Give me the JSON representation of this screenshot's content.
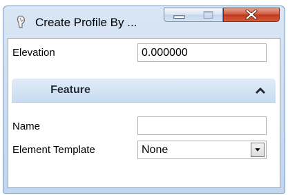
{
  "window": {
    "title": "Create Profile By ...",
    "icon": "profile-tool-icon"
  },
  "fields": {
    "elevation_label": "Elevation",
    "elevation_value": "0.000000"
  },
  "feature_section": {
    "title": "Feature",
    "collapse_icon": "chevron-up-icon",
    "name_label": "Name",
    "name_value": "",
    "template_label": "Element Template",
    "template_value": "None"
  }
}
